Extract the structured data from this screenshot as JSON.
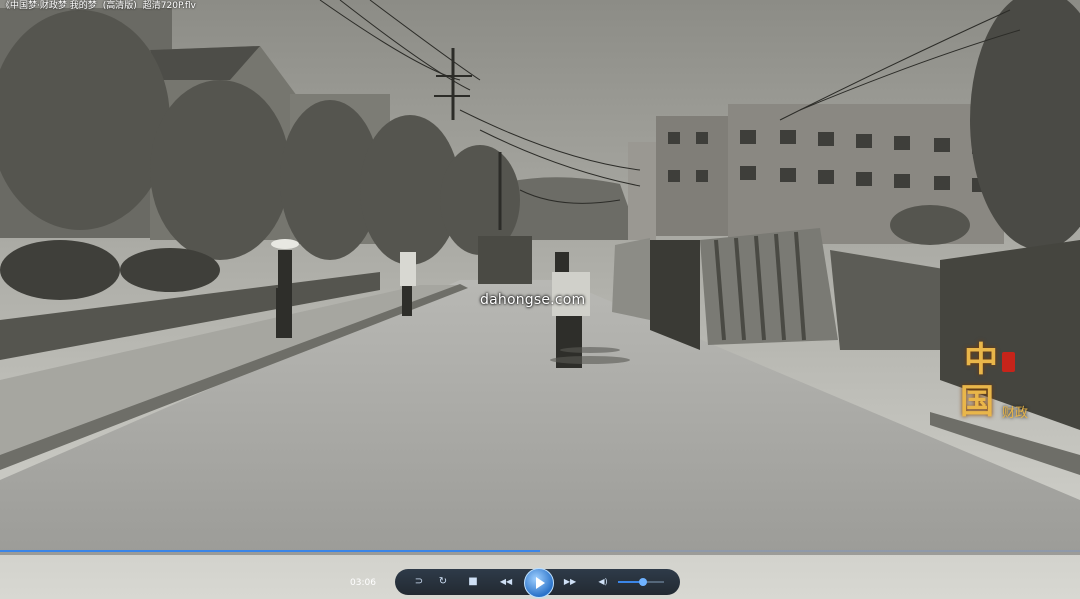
{
  "window": {
    "title_parts": [
      "《中国梦·财政梦 我的梦",
      "(高清版)",
      "超清720P.flv"
    ]
  },
  "video": {
    "watermark": "dahongse.com",
    "logo_chars": [
      "中",
      "国"
    ],
    "logo_small": "财政"
  },
  "player": {
    "current_time": "03:06",
    "progress_fraction": 0.5,
    "volume_fraction": 0.55,
    "buttons": {
      "repeat_icon": "⊃",
      "loop_icon": "↻",
      "stop_icon": "■",
      "prev_icon": "◀◀",
      "next_icon": "▶▶",
      "volume_icon": "◀)"
    }
  }
}
